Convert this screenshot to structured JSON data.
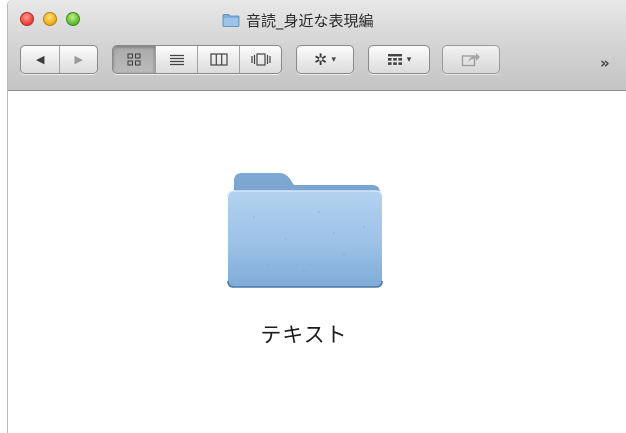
{
  "window": {
    "title": "音読_身近な表現編",
    "title_icon": "folder-icon"
  },
  "toolbar": {
    "back_icon": "◀",
    "forward_icon": "▶",
    "view_icon": "icon-grid-icon",
    "view_list_icon": "list-icon",
    "view_columns_icon": "columns-icon",
    "view_coverflow_icon": "coverflow-icon",
    "action_icon": "✲",
    "arrange_icon": "arrange-grid-icon",
    "share_icon": "share-icon",
    "dropdown_caret": "▾",
    "overflow_label": "»"
  },
  "content": {
    "items": [
      {
        "label": "テキスト",
        "kind": "folder"
      }
    ]
  },
  "colors": {
    "folder_blue": "#8fb8de",
    "titlebar": "#d6d6d6"
  }
}
